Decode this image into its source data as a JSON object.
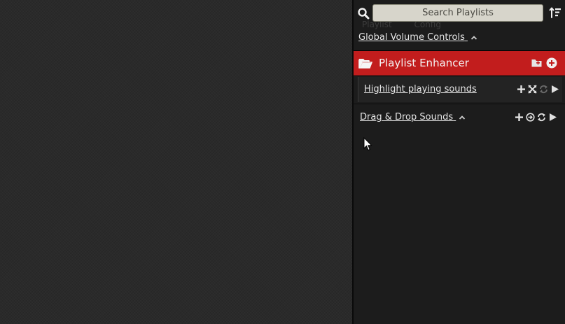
{
  "background_tabs": [
    "Playlist",
    "Config"
  ],
  "search": {
    "placeholder": "Search Playlists",
    "icon": "magnifier-icon",
    "sort_icon": "sort-order-icon"
  },
  "global_volume": {
    "label": "Global Volume Controls",
    "state": "expanded"
  },
  "playlist": {
    "title": "Playlist Enhancer",
    "header_color": "#c21d1d",
    "controls": [
      "folder-create-icon",
      "add-circle-icon"
    ],
    "sounds": [
      {
        "name": "Highlight playing sounds",
        "controls": [
          "add-icon",
          "shuffle-icon",
          "repeat-icon",
          "play-icon"
        ]
      }
    ]
  },
  "drag_drop": {
    "label": "Drag & Drop Sounds",
    "state": "expanded",
    "controls": [
      "add-icon",
      "forward-circle-icon",
      "repeat-icon",
      "play-icon"
    ]
  },
  "colors": {
    "accent": "#c21d1d",
    "sidebar_bg": "#1c1c1c",
    "text": "#e6e6e6",
    "search_bg": "#d7d5cb"
  }
}
